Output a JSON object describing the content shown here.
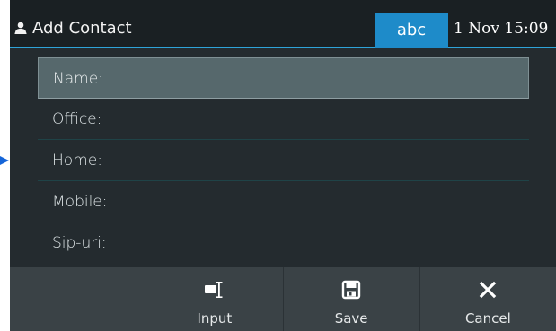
{
  "header": {
    "title": "Add Contact",
    "input_mode": "abc",
    "datetime": "1 Nov 15:09",
    "icon": "user-icon"
  },
  "fields": [
    {
      "label": "Name:",
      "selected": true
    },
    {
      "label": "Office:",
      "selected": false
    },
    {
      "label": "Home:",
      "selected": false
    },
    {
      "label": "Mobile:",
      "selected": false
    },
    {
      "label": "Sip-uri:",
      "selected": false
    }
  ],
  "softkeys": [
    {
      "label": "",
      "icon": ""
    },
    {
      "label": "Input",
      "icon": "input-cursor-icon"
    },
    {
      "label": "Save",
      "icon": "save-icon"
    },
    {
      "label": "Cancel",
      "icon": "close-icon"
    }
  ],
  "colors": {
    "background": "#242b2f",
    "header_background": "#1a2023",
    "accent": "#2ea3d8",
    "mode_badge": "#1e8bc9",
    "selected_row": "#56686c",
    "softkey_bar": "#3a4246",
    "side_arrow": "#1565d8"
  }
}
